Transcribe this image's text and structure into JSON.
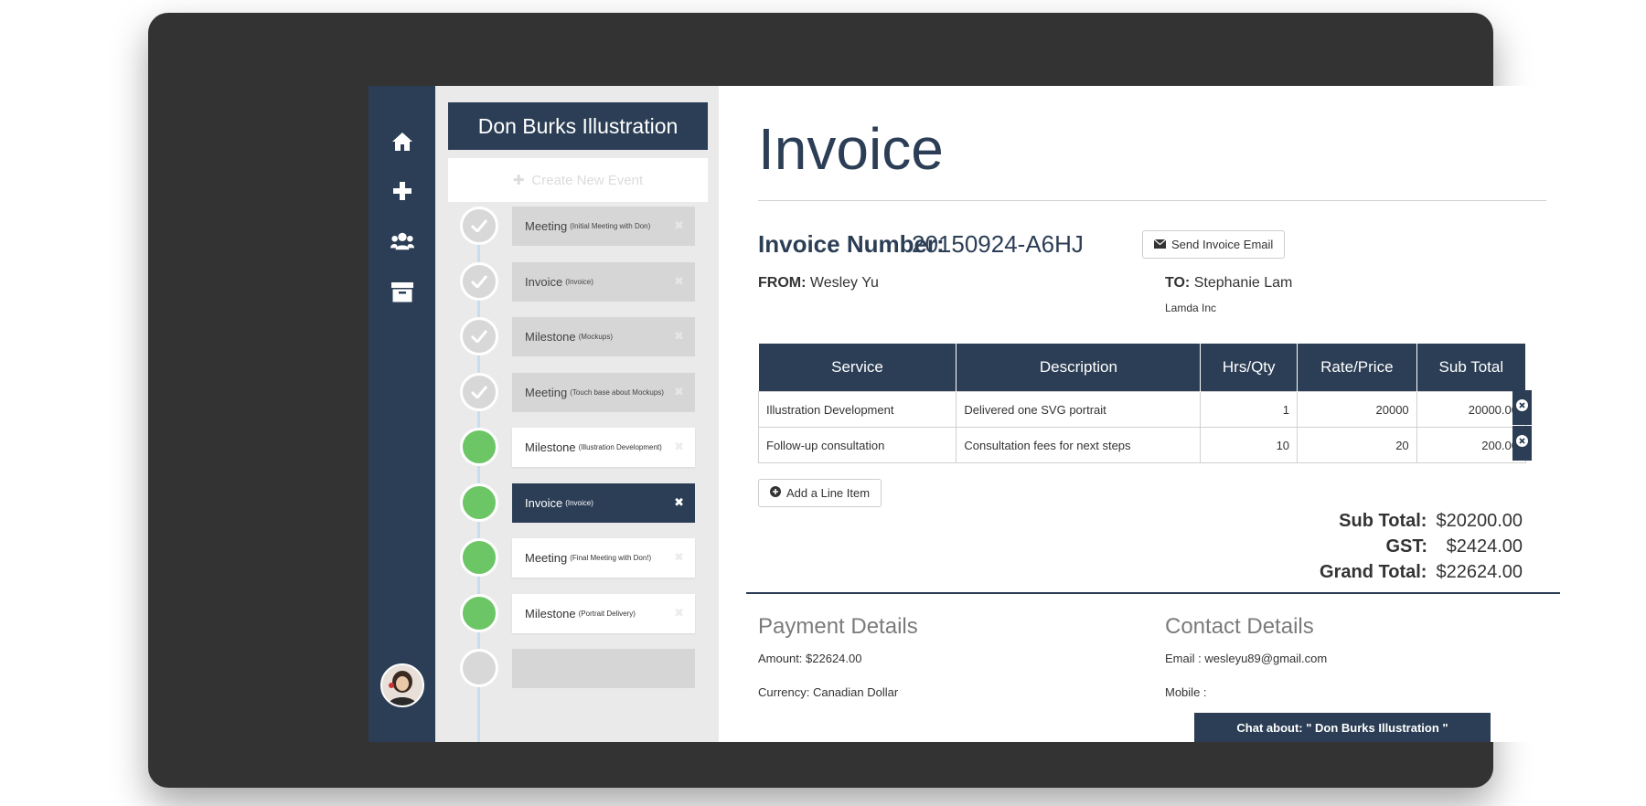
{
  "sidebar": {
    "icons": [
      "home-icon",
      "plus-icon",
      "users-icon",
      "archive-icon"
    ]
  },
  "events_panel": {
    "client_name": "Don Burks Illustration",
    "create_event_label": "Create New Event",
    "events": [
      {
        "title": "Meeting",
        "sub": "(Initial Meeting with Don)",
        "state": "done"
      },
      {
        "title": "Invoice",
        "sub": "(Invoice)",
        "state": "done"
      },
      {
        "title": "Milestone",
        "sub": "(Mockups)",
        "state": "done"
      },
      {
        "title": "Meeting",
        "sub": "(Touch base about Mockups)",
        "state": "done"
      },
      {
        "title": "Milestone",
        "sub": "(Illustration Development)",
        "state": "future"
      },
      {
        "title": "Invoice",
        "sub": "(Invoice)",
        "state": "selected"
      },
      {
        "title": "Meeting",
        "sub": "(Final Meeting with Don!)",
        "state": "future"
      },
      {
        "title": "Milestone",
        "sub": "(Portrait Delivery)",
        "state": "future"
      }
    ]
  },
  "invoice": {
    "title": "Invoice",
    "number_label": "Invoice Number:",
    "number": "20150924-A6HJ",
    "send_email_label": "Send Invoice Email",
    "from_label": "FROM:",
    "from_name": "Wesley Yu",
    "to_label": "TO:",
    "to_name": "Stephanie Lam",
    "to_company": "Lamda Inc",
    "columns": [
      "Service",
      "Description",
      "Hrs/Qty",
      "Rate/Price",
      "Sub Total"
    ],
    "rows": [
      {
        "service": "Illustration Development",
        "description": "Delivered one SVG portrait",
        "qty": "1",
        "rate": "20000",
        "subtotal": "20000.00"
      },
      {
        "service": "Follow-up consultation",
        "description": "Consultation fees for next steps",
        "qty": "10",
        "rate": "20",
        "subtotal": "200.00"
      }
    ],
    "add_line_label": "Add a Line Item",
    "subtotal_label": "Sub Total:",
    "subtotal": "$20200.00",
    "gst_label": "GST:",
    "gst": "$2424.00",
    "grand_total_label": "Grand Total:",
    "grand_total": "$22624.00"
  },
  "payment": {
    "title": "Payment Details",
    "amount": "Amount: $22624.00",
    "currency": "Currency: Canadian Dollar"
  },
  "contact": {
    "title": "Contact Details",
    "email": "Email : wesleyu89@gmail.com",
    "mobile": "Mobile :"
  },
  "chat_label": "Chat about: \" Don Burks Illustration \"",
  "colors": {
    "navy": "#2b3e55",
    "active_green": "#6cc666",
    "done_grey": "#d6d6d6"
  }
}
